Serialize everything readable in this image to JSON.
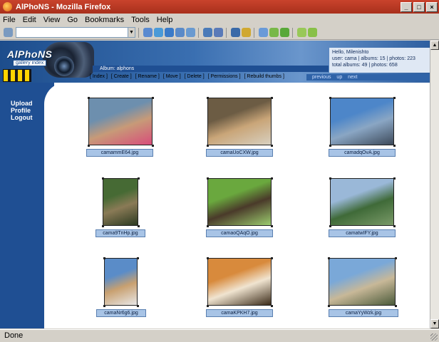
{
  "window": {
    "title": "AlPhoNS - Mozilla Firefox"
  },
  "menu": [
    "File",
    "Edit",
    "View",
    "Go",
    "Bookmarks",
    "Tools",
    "Help"
  ],
  "status": {
    "text": "Done"
  },
  "site": {
    "logo": "AlPhoNS",
    "logo_sub": "gallery index",
    "album_bar": "Album: alphons",
    "user": {
      "greeting": "Hello, Milenishto",
      "line1": "user: cama | albums: 15 | photos: 223",
      "line2": "total albums: 49 | photos: 658"
    },
    "commands": [
      "[ Index ]",
      "[ Create ]",
      "[ Rename ]",
      "[ Move ]",
      "[ Delete ]",
      "[ Permissions ]",
      "[ Rebuild thumbs ]"
    ],
    "pager": [
      "previous",
      "up",
      "next"
    ],
    "sidebar": [
      "Upload",
      "Profile",
      "Logout"
    ]
  },
  "photos": [
    {
      "file": "camammE64.jpg",
      "colors": [
        "#6d8fae",
        "#c79a78",
        "#d84d7a"
      ]
    },
    {
      "file": "camaUoCXW.jpg",
      "colors": [
        "#6c5c44",
        "#c9a578",
        "#d8d0c0"
      ]
    },
    {
      "file": "camadqOvA.jpg",
      "colors": [
        "#4d86c9",
        "#8aa6c4",
        "#3d4a5a"
      ]
    },
    {
      "file": "cama9TnHp.jpg",
      "colors": [
        "#466a34",
        "#8a7a56",
        "#2c3a20"
      ]
    },
    {
      "file": "camaoQAqO.jpg",
      "colors": [
        "#6aa83e",
        "#4a3a2a",
        "#9ccc6e"
      ]
    },
    {
      "file": "camatwIFY.jpg",
      "colors": [
        "#9ab8d8",
        "#3f6a38",
        "#7a9a68"
      ]
    },
    {
      "file": "camaNr6g6.jpg",
      "colors": [
        "#5a8cc8",
        "#c8a070",
        "#e8e8e8"
      ]
    },
    {
      "file": "camaKPKH7.jpg",
      "colors": [
        "#d88a3c",
        "#f0e4d0",
        "#3a2a18"
      ]
    },
    {
      "file": "camaYyWzk.jpg",
      "colors": [
        "#7aa8d8",
        "#c8b898",
        "#4a5a3a"
      ]
    }
  ]
}
